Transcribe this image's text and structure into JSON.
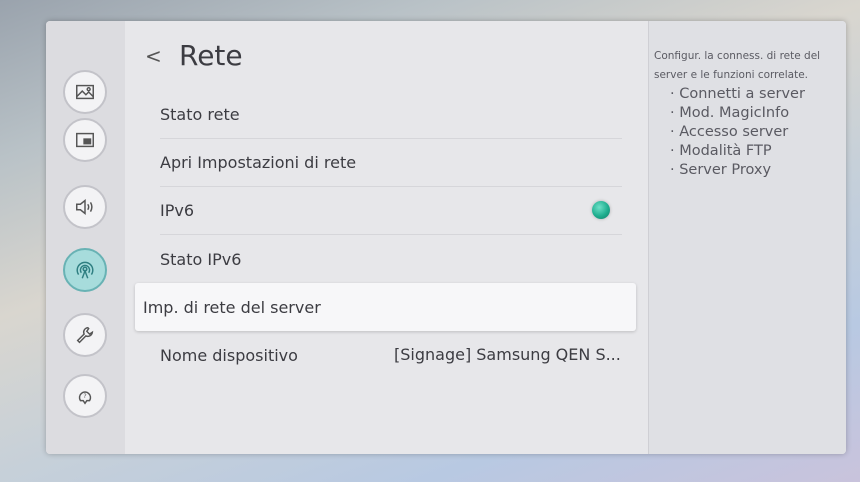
{
  "nav": {
    "icons": [
      "picture-icon",
      "screen-icon",
      "sound-icon",
      "network-icon",
      "wrench-icon",
      "support-icon"
    ],
    "active_index": 3,
    "active_color": "#a7dcdc"
  },
  "header": {
    "back_glyph": "<",
    "title": "Rete"
  },
  "menu": {
    "items": [
      {
        "label": "Stato rete"
      },
      {
        "label": "Apri Impostazioni di rete"
      },
      {
        "label": "IPv6",
        "toggle_on": true
      },
      {
        "label": "Stato IPv6"
      },
      {
        "label": "Imp. di rete del server",
        "selected": true
      },
      {
        "label": "Nome dispositivo",
        "value": "[Signage] Samsung QEN S..."
      }
    ]
  },
  "description": {
    "text": "Configur. la conness. di rete del server e le funzioni correlate.",
    "features": [
      "· Connetti a server",
      "· Mod. MagicInfo",
      "· Accesso server",
      "· Modalità FTP",
      "· Server Proxy"
    ]
  },
  "colors": {
    "toggle_on": "#1fae8f",
    "selected_bg": "#f7f7f9"
  }
}
